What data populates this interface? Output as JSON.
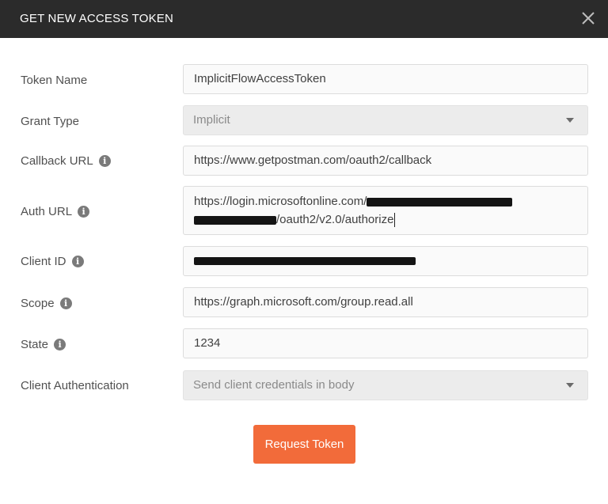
{
  "dialog": {
    "title": "GET NEW ACCESS TOKEN"
  },
  "form": {
    "token_name": {
      "label": "Token Name",
      "value": "ImplicitFlowAccessToken"
    },
    "grant_type": {
      "label": "Grant Type",
      "value": "Implicit"
    },
    "callback_url": {
      "label": "Callback URL",
      "value": "https://www.getpostman.com/oauth2/callback"
    },
    "auth_url": {
      "label": "Auth URL",
      "value_prefix": "https://login.microsoftonline.com/",
      "value_suffix": "/oauth2/v2.0/authorize"
    },
    "client_id": {
      "label": "Client ID"
    },
    "scope": {
      "label": "Scope",
      "value": "https://graph.microsoft.com/group.read.all"
    },
    "state": {
      "label": "State",
      "value": "1234"
    },
    "client_auth": {
      "label": "Client Authentication",
      "value": "Send client credentials in body"
    }
  },
  "actions": {
    "request_token_label": "Request Token"
  },
  "icons": {
    "info": "info-icon",
    "close": "close-icon",
    "dropdown": "chevron-down-icon"
  },
  "colors": {
    "titlebar": "#2b2b2b",
    "primary_button": "#f26b3a"
  }
}
